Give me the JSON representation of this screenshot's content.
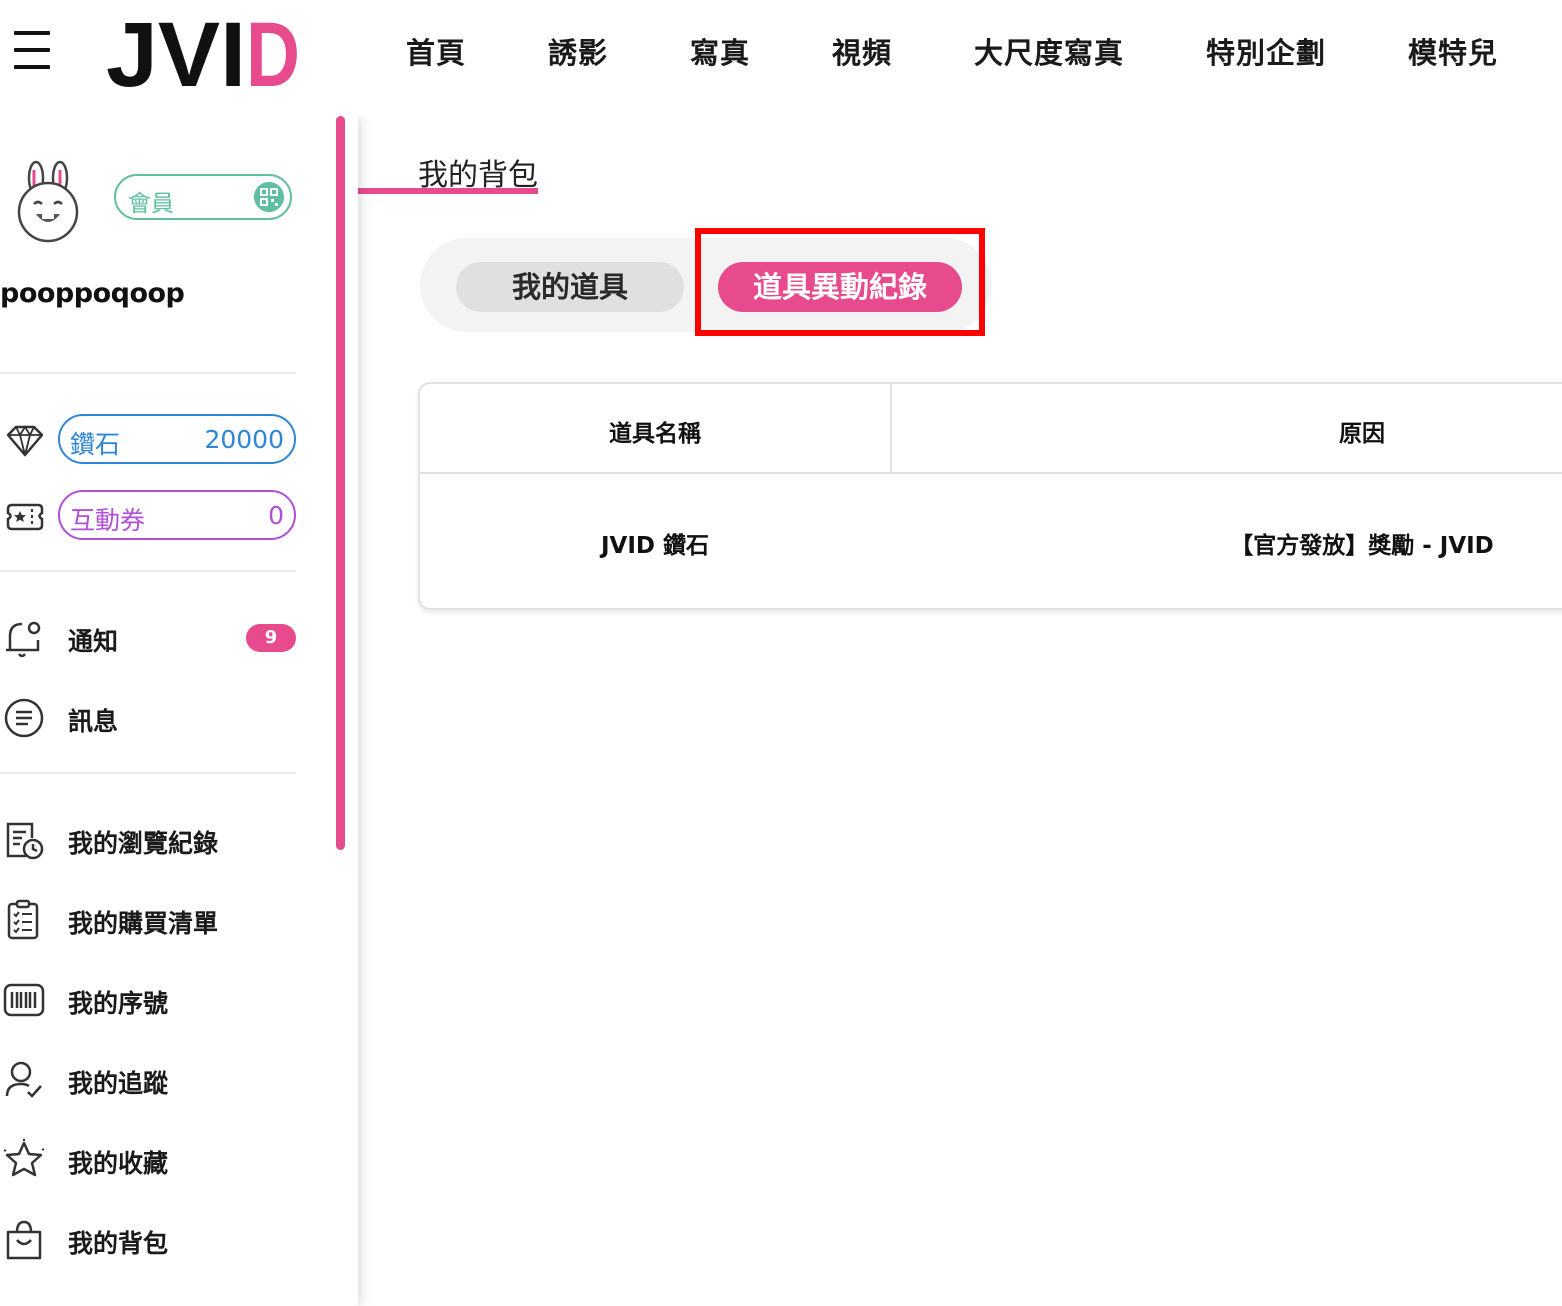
{
  "header": {
    "logo_text": "JVID",
    "nav": [
      {
        "label": "首頁"
      },
      {
        "label": "誘影"
      },
      {
        "label": "寫真"
      },
      {
        "label": "視頻"
      },
      {
        "label": "大尺度寫真"
      },
      {
        "label": "特別企劃"
      },
      {
        "label": "模特兒"
      }
    ]
  },
  "sidebar": {
    "member_label": "會員",
    "username": "pooppoqoop",
    "wallet": {
      "diamond": {
        "label": "鑽石",
        "value": "20000"
      },
      "ticket": {
        "label": "互動券",
        "value": "0"
      }
    },
    "notifications": {
      "label": "通知",
      "badge": "9"
    },
    "messages": {
      "label": "訊息"
    },
    "menu": [
      {
        "label": "我的瀏覽紀錄",
        "icon": "history-icon"
      },
      {
        "label": "我的購買清單",
        "icon": "clipboard-list-icon"
      },
      {
        "label": "我的序號",
        "icon": "barcode-icon"
      },
      {
        "label": "我的追蹤",
        "icon": "user-check-icon"
      },
      {
        "label": "我的收藏",
        "icon": "star-icon"
      },
      {
        "label": "我的背包",
        "icon": "bag-icon"
      }
    ]
  },
  "main": {
    "title": "我的背包",
    "tabs": [
      {
        "label": "我的道具",
        "active": false
      },
      {
        "label": "道具異動紀錄",
        "active": true
      }
    ],
    "table": {
      "headers": [
        "道具名稱",
        "原因"
      ],
      "rows": [
        [
          "JVID 鑽石",
          "【官方發放】獎勵 - JVID"
        ]
      ]
    }
  },
  "colors": {
    "accent": "#e74b8e",
    "member": "#5fbfa0",
    "diamond": "#2f86d8",
    "ticket": "#b04fd8",
    "highlight": "#ff0000"
  }
}
